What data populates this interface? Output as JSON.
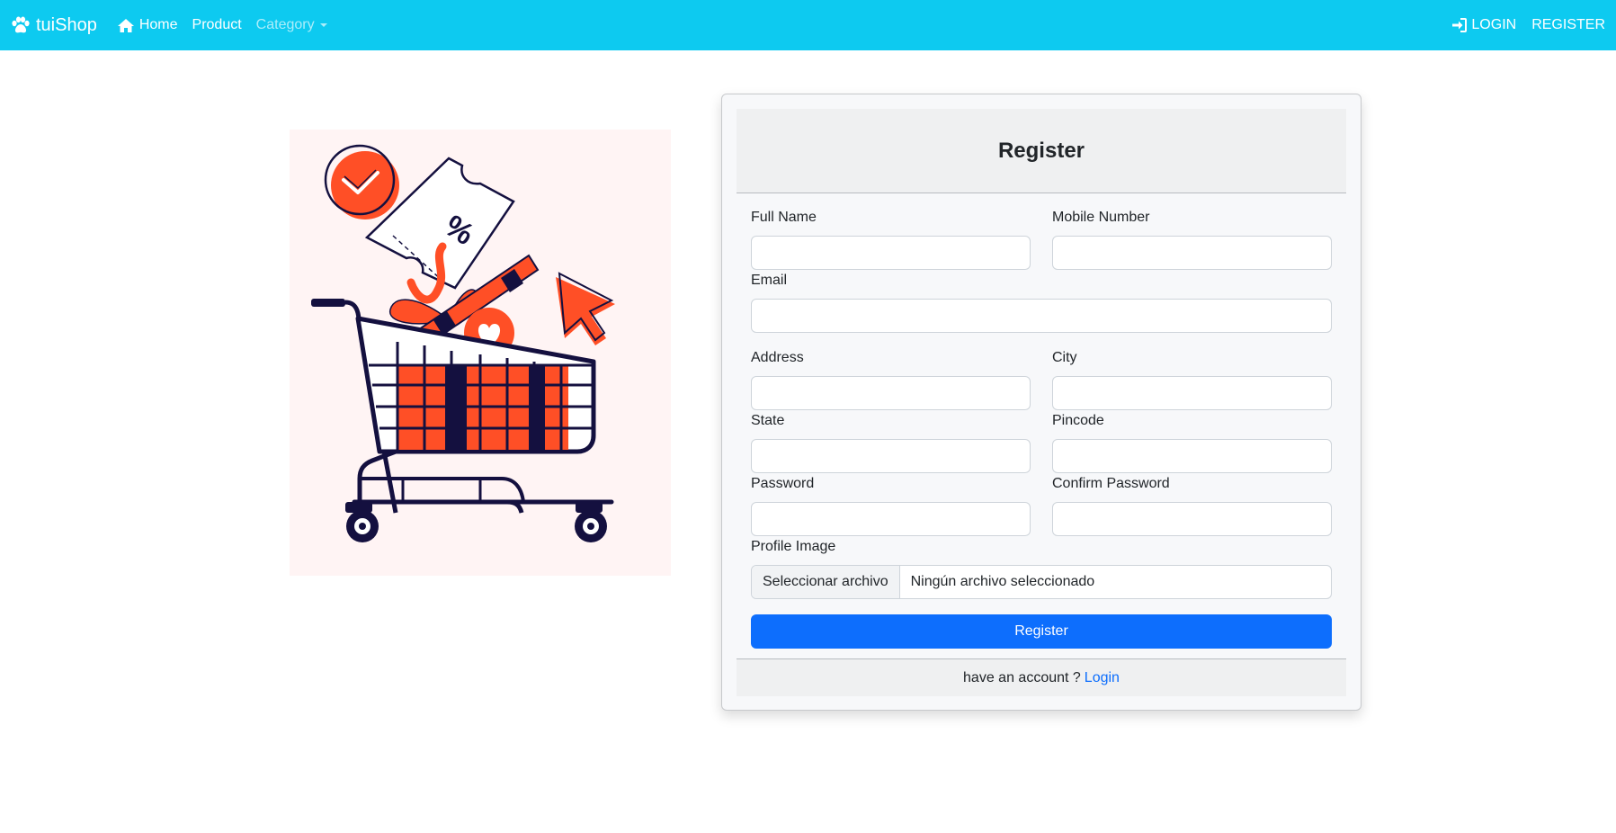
{
  "navbar": {
    "brand": "tuiShop",
    "home": "Home",
    "product": "Product",
    "category": "Category",
    "login": "LOGIN",
    "register": "REGISTER",
    "bg_color": "#0dcaf0"
  },
  "form": {
    "title": "Register",
    "full_name_label": "Full Name",
    "mobile_label": "Mobile Number",
    "email_label": "Email",
    "address_label": "Address",
    "city_label": "City",
    "state_label": "State",
    "pincode_label": "Pincode",
    "password_label": "Password",
    "confirm_password_label": "Confirm Password",
    "profile_image_label": "Profile Image",
    "file_button": "Seleccionar archivo",
    "file_status": "Ningún archivo seleccionado",
    "submit_label": "Register",
    "submit_color": "#0d6efd",
    "footer_text": "have an account ?",
    "footer_link": "Login"
  },
  "illustration": {
    "icons": [
      "shopping-cart-icon",
      "check-badge-icon",
      "discount-ticket-icon",
      "cursor-arrow-icon",
      "heart-icon"
    ],
    "accent_color": "#ff4f26",
    "ink_color": "#14103f"
  }
}
